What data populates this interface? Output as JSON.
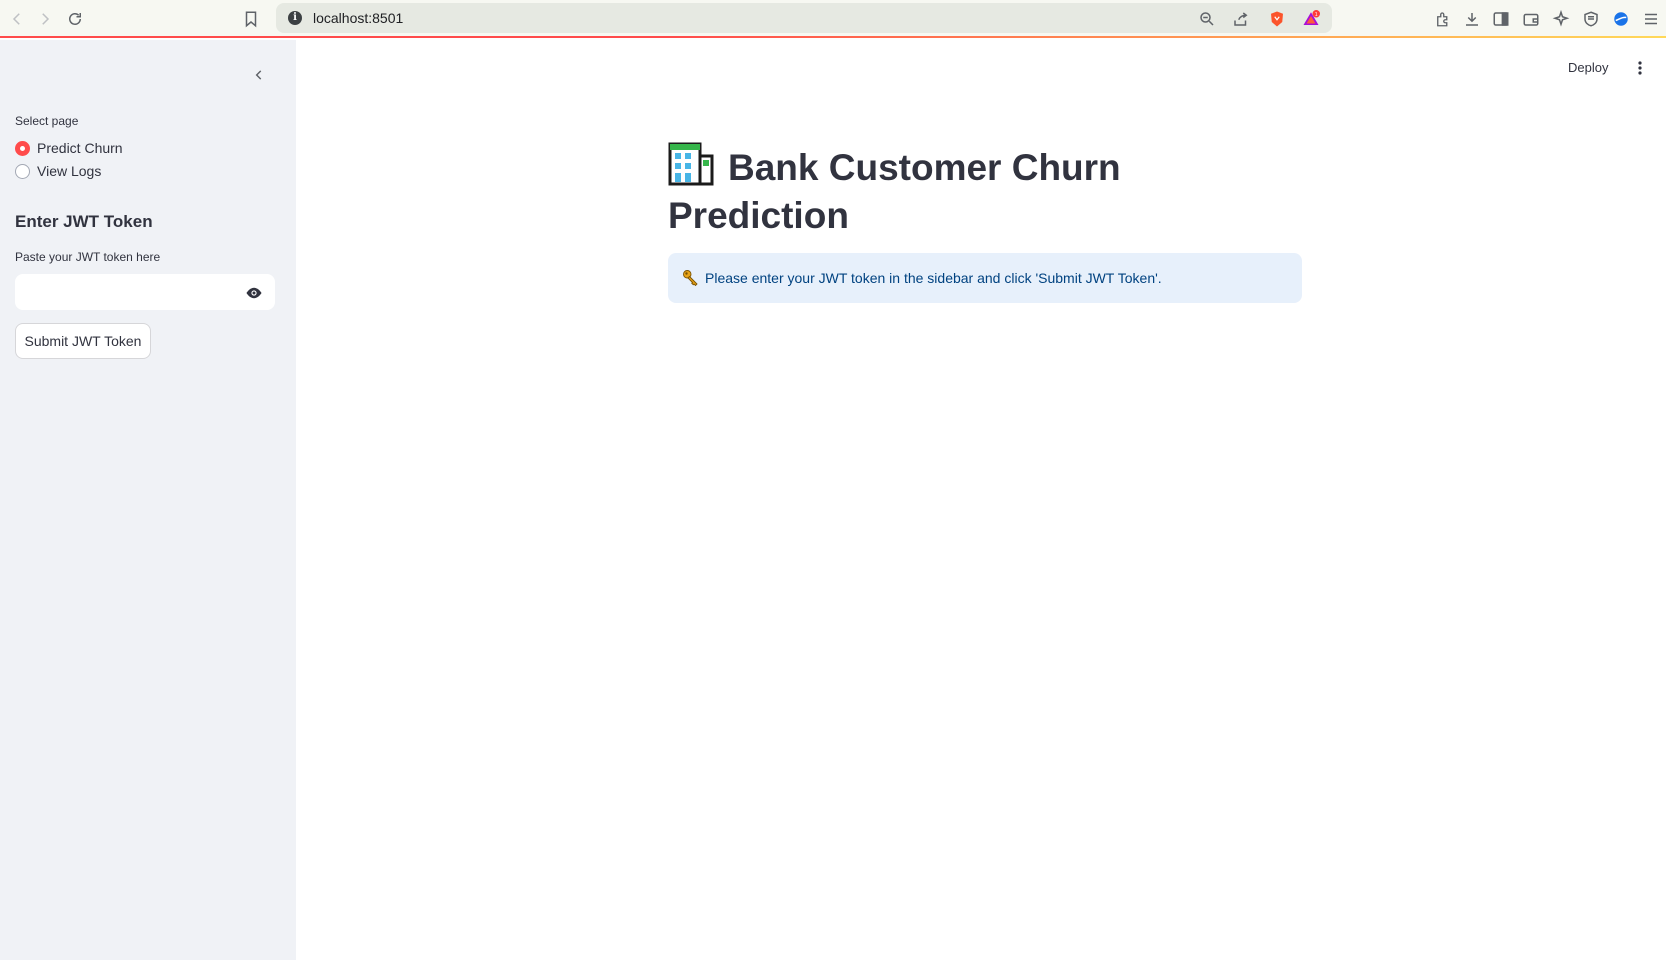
{
  "browser": {
    "url": "localhost:8501",
    "notification_count": "1"
  },
  "sidebar": {
    "radio_label": "Select page",
    "pages": [
      {
        "label": "Predict Churn",
        "selected": true
      },
      {
        "label": "View Logs",
        "selected": false
      }
    ],
    "heading": "Enter JWT Token",
    "input_label": "Paste your JWT token here",
    "input_value": "",
    "submit_label": "Submit JWT Token"
  },
  "header": {
    "deploy_label": "Deploy"
  },
  "main": {
    "title": "Bank Customer Churn Prediction",
    "info_message": "Please enter your JWT token in the sidebar and click 'Submit JWT Token'."
  },
  "colors": {
    "accent": "#ff4b4b",
    "sidebar_bg": "#f0f2f6",
    "info_bg": "#e7f0fb",
    "info_text": "#004280"
  },
  "icons": {
    "title": "office-building-icon",
    "info": "key-icon"
  }
}
